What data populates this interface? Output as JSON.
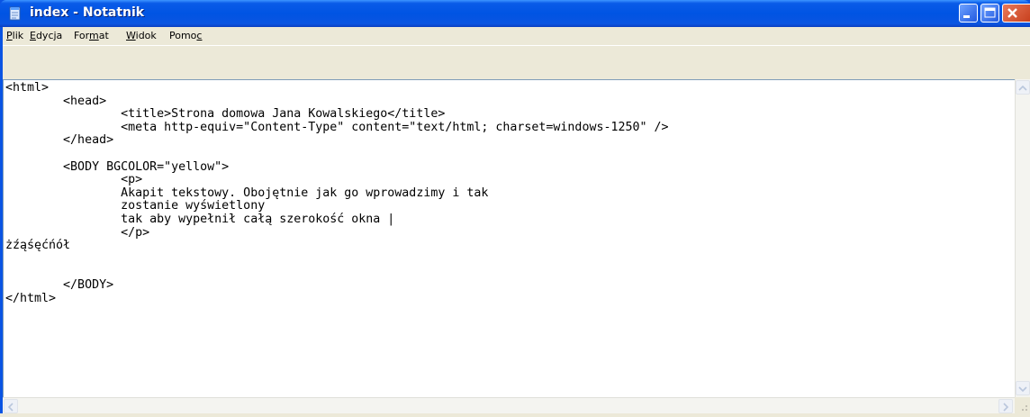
{
  "window": {
    "title": "index - Notatnik"
  },
  "menu": [
    {
      "label": "Plik",
      "accel_index": 0
    },
    {
      "label": "Edycja",
      "accel_index": 0
    },
    {
      "label": "Format",
      "accel_index": 3
    },
    {
      "label": "Widok",
      "accel_index": 0
    },
    {
      "label": "Pomoc",
      "accel_index": 4
    }
  ],
  "editor": {
    "content": "<html>\n\t<head>\n\t\t<title>Strona domowa Jana Kowalskiego</title>\n\t\t<meta http-equiv=\"Content-Type\" content=\"text/html; charset=windows-1250\" />\n\t</head>\n\n\t<BODY BGCOLOR=\"yellow\">\n\t\t<p>\n\t\tAkapit tekstowy. Obojętnie jak go wprowadzimy i tak\n\t\tzostanie wyświetlony\n\t\ttak aby wypełnił całą szerokość okna |\n\t\t</p>\nżźąśęćńół\n\n\n\t</BODY>\n</html>"
  },
  "colors": {
    "titlebar": "#0054e3",
    "close_button": "#c8401e",
    "menubar": "#ece9d8",
    "editor_bg": "#ffffff"
  }
}
